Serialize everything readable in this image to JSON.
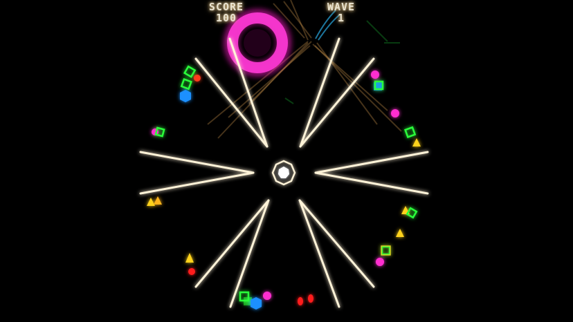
{
  "hud": {
    "score_label": "SCORE",
    "score_value": "100",
    "wave_label": "WAVE",
    "wave_value": "1"
  },
  "colors": {
    "background": "#000000",
    "beam": "#fff3d8",
    "beam_glow": "#ffb45a",
    "enemy_green": "#2bff3a",
    "enemy_magenta": "#ff2fd0",
    "enemy_blue": "#1e90ff",
    "enemy_yellow": "#ffd21e",
    "enemy_red": "#ff1e1e",
    "explosion": "#ff1ec8"
  },
  "icons": {
    "player_ship": "octagon-ship-icon"
  }
}
